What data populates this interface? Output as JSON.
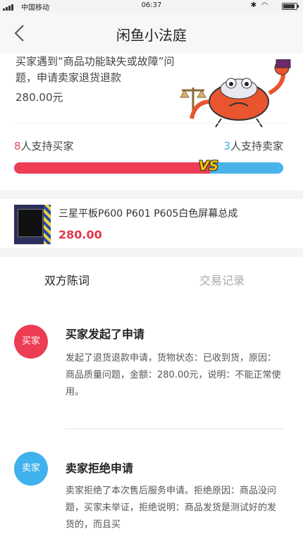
{
  "status_bar": {
    "carrier": "中国移动",
    "time": "06:37"
  },
  "nav": {
    "title": "闲鱼小法庭"
  },
  "case": {
    "description": "买家遇到“商品功能缺失或故障”问题，申请卖家退货退款",
    "amount": "280.00元"
  },
  "support": {
    "buyer_count": "8",
    "buyer_label": "人支持买家",
    "seller_count": "3",
    "seller_label": "人支持卖家",
    "buyer_share": 0.7273,
    "vs_label": "VS",
    "colors": {
      "buyer": "#ee3e54",
      "seller": "#48b3ea"
    }
  },
  "product": {
    "name": "三星平板P600 P601 P605白色屏幕总成",
    "price": "280.00"
  },
  "tabs": [
    {
      "label": "双方陈词",
      "active": true
    },
    {
      "label": "交易记录",
      "active": false
    }
  ],
  "events": [
    {
      "avatar_label": "买家",
      "title": "买家发起了申请",
      "body": "发起了退货退款申请，货物状态：已收到货，原因：商品质量问题，金额：280.00元，说明：不能正常使用。"
    },
    {
      "avatar_label": "卖家",
      "title": "卖家拒绝申请",
      "body": "卖家拒绝了本次售后服务申请。拒绝原因：商品没问题，买家未举证，拒绝说明：商品发货是测试好的发货的，而且买"
    }
  ]
}
